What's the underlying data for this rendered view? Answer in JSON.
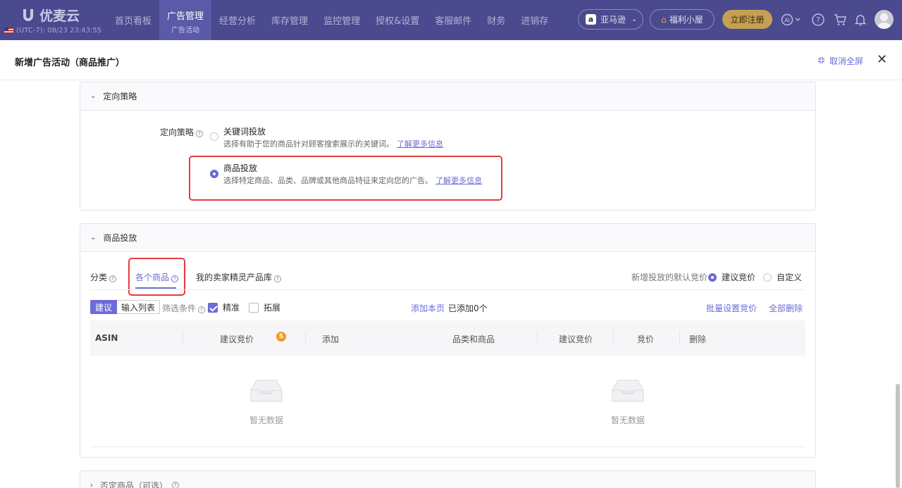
{
  "brand": {
    "name": "优麦云",
    "timezone": "(UTC-7): 08/23 23:43:55"
  },
  "nav": {
    "items": [
      {
        "label": "首页看板",
        "sub": ""
      },
      {
        "label": "广告管理",
        "sub": "广告活动"
      },
      {
        "label": "经营分析",
        "sub": ""
      },
      {
        "label": "库存管理",
        "sub": ""
      },
      {
        "label": "监控管理",
        "sub": ""
      },
      {
        "label": "授权&设置",
        "sub": ""
      },
      {
        "label": "客服邮件",
        "sub": ""
      },
      {
        "label": "财务",
        "sub": ""
      },
      {
        "label": "进销存",
        "sub": ""
      }
    ],
    "active_index": 1,
    "region": "亚马逊",
    "welfare": "福利小屋",
    "register": "立即注册"
  },
  "dialog": {
    "title": "新增广告活动（商品推广）",
    "exit_fullscreen": "取消全屏"
  },
  "targeting": {
    "section_title": "定向策略",
    "field_label": "定向策略",
    "options": [
      {
        "title": "关键词投放",
        "desc": "选择有助于您的商品针对顾客搜索展示的关键词。",
        "link": "了解更多信息",
        "selected": false
      },
      {
        "title": "商品投放",
        "desc": "选择特定商品、品类、品牌或其他商品特征来定向您的广告。",
        "link": "了解更多信息",
        "selected": true
      }
    ]
  },
  "product_targeting": {
    "section_title": "商品投放",
    "tabs": [
      "分类",
      "各个商品",
      "我的卖家精灵产品库"
    ],
    "active_tab": 1,
    "default_bid_label": "新增投放的默认竞价",
    "bid_options": [
      {
        "label": "建议竞价",
        "selected": true
      },
      {
        "label": "自定义",
        "selected": false
      }
    ],
    "toolbar": {
      "suggest_btn": "建议",
      "input_list_btn": "输入列表",
      "filter_label": "筛选条件",
      "precise": "精准",
      "expand": "拓展",
      "add_page": "添加本页",
      "added_count": "已添加0个",
      "batch_bid": "批量设置竞价",
      "delete_all": "全部删除"
    },
    "left_columns": [
      "ASIN",
      "建议竞价",
      "添加"
    ],
    "right_columns": [
      "品类和商品",
      "建议竞价",
      "竞价",
      "删除"
    ],
    "empty_text": "暂无数据"
  },
  "negative": {
    "section_title": "否定商品（可选）"
  }
}
